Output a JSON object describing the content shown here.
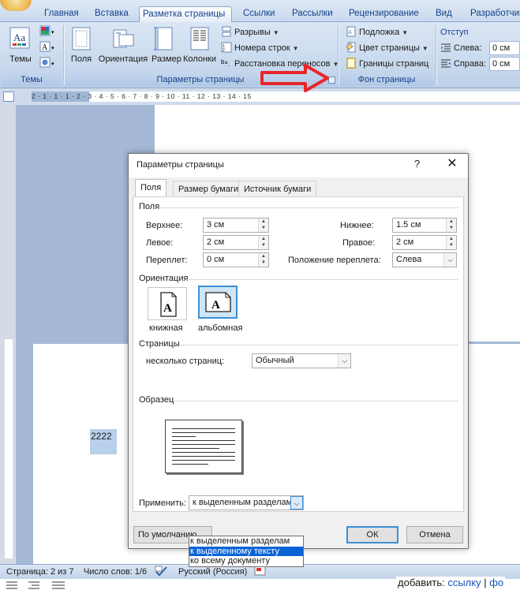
{
  "ribbon": {
    "tabs": [
      "Главная",
      "Вставка",
      "Разметка страницы",
      "Ссылки",
      "Рассылки",
      "Рецензирование",
      "Вид",
      "Разработчик"
    ],
    "themes": {
      "btn": "Темы",
      "group": "Темы"
    },
    "page_setup": {
      "fields_btn": "Поля",
      "orientation_btn": "Ориентация",
      "size_btn": "Размер",
      "columns_btn": "Колонки",
      "breaks": "Разрывы",
      "line_numbers": "Номера строк",
      "hyphenation": "Расстановка переносов",
      "group": "Параметры страницы"
    },
    "page_background": {
      "watermark": "Подложка",
      "page_color": "Цвет страницы",
      "page_borders": "Границы страниц",
      "group": "Фон страницы"
    },
    "indent": {
      "title": "Отступ",
      "left_label": "Слева:",
      "left_value": "0 см",
      "right_label": "Справа:",
      "right_value": "0 см"
    }
  },
  "ruler": {
    "text": "2 · 1 · 1 · 1 · 2 · 3 · 4 · 5 · 6 · 7 · 8 · 9 · 10 · 11 · 12 · 13 · 14 · 15"
  },
  "document": {
    "selected_text": "2222"
  },
  "dialog": {
    "title": "Параметры страницы",
    "help": "?",
    "close": "✕",
    "tabs": [
      "Поля",
      "Размер бумаги",
      "Источник бумаги"
    ],
    "margins_section": "Поля",
    "top_label": "Верхнее:",
    "top_value": "3 см",
    "bottom_label": "Нижнее:",
    "bottom_value": "1.5 см",
    "left_label": "Левое:",
    "left_value": "2 см",
    "right_label": "Правое:",
    "right_value": "2 см",
    "gutter_label": "Переплет:",
    "gutter_value": "0 см",
    "gutter_pos_label": "Положение переплета:",
    "gutter_pos_value": "Слева",
    "orientation_section": "Ориентация",
    "portrait": "книжная",
    "landscape": "альбомная",
    "pages_section": "Страницы",
    "multiple_pages_label": "несколько страниц:",
    "multiple_pages_value": "Обычный",
    "preview_section": "Образец",
    "apply_label": "Применить:",
    "apply_value": "к выделенным разделам",
    "apply_options": [
      "к выделенным разделам",
      "к выделенному тексту",
      "ко всему документу"
    ],
    "apply_selected_index": 1,
    "default_btn": "По умолчанию...",
    "ok_btn": "ОК",
    "cancel_btn": "Отмена"
  },
  "statusbar": {
    "page": "Страница: 2 из 7",
    "words": "Число слов: 1/6",
    "language": "Русский (Россия)"
  },
  "footer": {
    "prefix": "добавить:",
    "link1": "ссылку",
    "sep": "|",
    "link2": "фо"
  },
  "colors": {
    "ribbon_text": "#15428b",
    "accent": "#3c8fd6",
    "selection": "#0b64d6",
    "annotation_arrow": "#e8262b"
  }
}
